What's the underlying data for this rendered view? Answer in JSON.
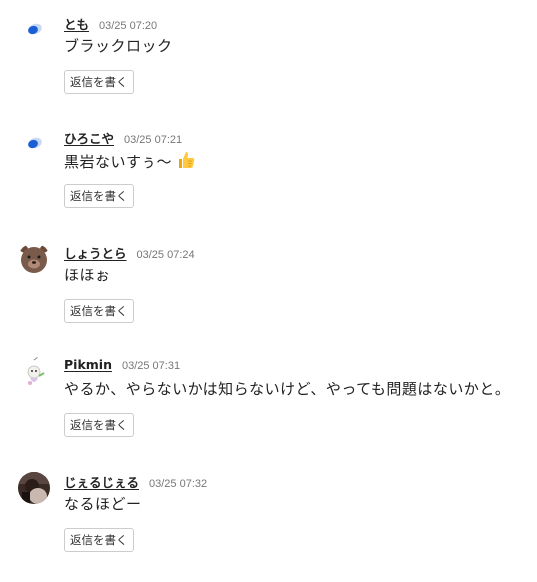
{
  "reply_label": "返信を書く",
  "comments": [
    {
      "username": "とも",
      "timestamp": "03/25 07:20",
      "text": "ブラックロック",
      "avatar_icon": "blue-blob-icon"
    },
    {
      "username": "ひろこや",
      "timestamp": "03/25 07:21",
      "text": "黒岩ないすぅ～",
      "trailing_emoji": "thumbs-up-icon",
      "avatar_icon": "blue-blob-icon"
    },
    {
      "username": "しょうとら",
      "timestamp": "03/25 07:24",
      "text": "ほほぉ",
      "avatar_icon": "bear-icon"
    },
    {
      "username": "Pikmin",
      "timestamp": "03/25 07:31",
      "text": "やるか、やらないかは知らないけど、やっても問題はないかと。",
      "avatar_icon": "pikmin-icon"
    },
    {
      "username": "じぇるじぇる",
      "timestamp": "03/25 07:32",
      "text": "なるほどー",
      "avatar_icon": "photo-avatar-icon"
    }
  ],
  "colors": {
    "avatar_blue": "#1a5fd6",
    "bear_brown": "#7a5a4a",
    "reply_border": "#cccccc",
    "timestamp": "#777777"
  }
}
